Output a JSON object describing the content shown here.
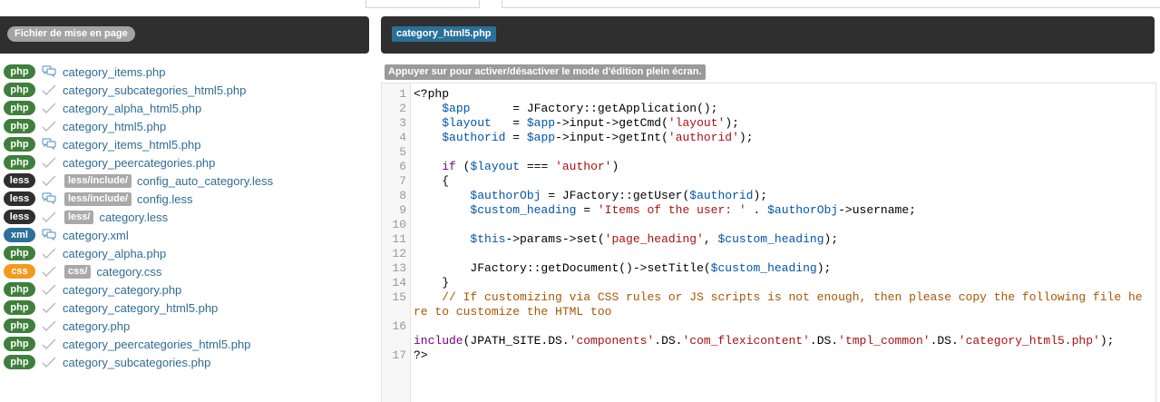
{
  "colors": {
    "php": "#3f7f3c",
    "less": "#2f2f2f",
    "xml": "#2a7099",
    "css": "#f39a1e",
    "link": "#2d6d96",
    "header_bg": "#2f2f2f"
  },
  "left_panel": {
    "header_label": "Fichier de mise en page",
    "files": [
      {
        "type": "php",
        "icon": "comment-icon",
        "folder": "",
        "name": "category_items.php"
      },
      {
        "type": "php",
        "icon": "check-icon",
        "folder": "",
        "name": "category_subcategories_html5.php"
      },
      {
        "type": "php",
        "icon": "check-icon",
        "folder": "",
        "name": "category_alpha_html5.php"
      },
      {
        "type": "php",
        "icon": "check-icon",
        "folder": "",
        "name": "category_html5.php"
      },
      {
        "type": "php",
        "icon": "comment-icon",
        "folder": "",
        "name": "category_items_html5.php"
      },
      {
        "type": "php",
        "icon": "check-icon",
        "folder": "",
        "name": "category_peercategories.php"
      },
      {
        "type": "less",
        "icon": "check-icon",
        "folder": "less/include/",
        "name": "config_auto_category.less"
      },
      {
        "type": "less",
        "icon": "comment-icon",
        "folder": "less/include/",
        "name": "config.less"
      },
      {
        "type": "less",
        "icon": "check-icon",
        "folder": "less/",
        "name": "category.less"
      },
      {
        "type": "xml",
        "icon": "comment-icon",
        "folder": "",
        "name": "category.xml"
      },
      {
        "type": "php",
        "icon": "check-icon",
        "folder": "",
        "name": "category_alpha.php"
      },
      {
        "type": "css",
        "icon": "check-icon",
        "folder": "css/",
        "name": "category.css"
      },
      {
        "type": "php",
        "icon": "check-icon",
        "folder": "",
        "name": "category_category.php"
      },
      {
        "type": "php",
        "icon": "check-icon",
        "folder": "",
        "name": "category_category_html5.php"
      },
      {
        "type": "php",
        "icon": "check-icon",
        "folder": "",
        "name": "category.php"
      },
      {
        "type": "php",
        "icon": "check-icon",
        "folder": "",
        "name": "category_peercategories_html5.php"
      },
      {
        "type": "php",
        "icon": "check-icon",
        "folder": "",
        "name": "category_subcategories.php"
      }
    ]
  },
  "right_panel": {
    "file_tag": "category_html5.php",
    "hint": "Appuyer sur pour activer/désactiver le mode d'édition plein écran.",
    "code_lines": [
      {
        "n": "1",
        "tokens": [
          [
            "t",
            "<?php"
          ]
        ]
      },
      {
        "n": "2",
        "tokens": [
          [
            "t",
            "    "
          ],
          [
            "v",
            "$app"
          ],
          [
            "t",
            "      = JFactory::getApplication();"
          ]
        ]
      },
      {
        "n": "3",
        "tokens": [
          [
            "t",
            "    "
          ],
          [
            "v",
            "$layout"
          ],
          [
            "t",
            "   = "
          ],
          [
            "v",
            "$app"
          ],
          [
            "t",
            "->input->getCmd("
          ],
          [
            "s",
            "'layout'"
          ],
          [
            "t",
            ");"
          ]
        ]
      },
      {
        "n": "4",
        "tokens": [
          [
            "t",
            "    "
          ],
          [
            "v",
            "$authorid"
          ],
          [
            "t",
            " = "
          ],
          [
            "v",
            "$app"
          ],
          [
            "t",
            "->input->getInt("
          ],
          [
            "s",
            "'authorid'"
          ],
          [
            "t",
            ");"
          ]
        ]
      },
      {
        "n": "5",
        "tokens": []
      },
      {
        "n": "6",
        "tokens": [
          [
            "t",
            "    "
          ],
          [
            "k",
            "if"
          ],
          [
            "t",
            " ("
          ],
          [
            "v",
            "$layout"
          ],
          [
            "t",
            " === "
          ],
          [
            "s",
            "'author'"
          ],
          [
            "t",
            ")"
          ]
        ]
      },
      {
        "n": "7",
        "tokens": [
          [
            "t",
            "    {"
          ]
        ]
      },
      {
        "n": "8",
        "tokens": [
          [
            "t",
            "        "
          ],
          [
            "v",
            "$authorObj"
          ],
          [
            "t",
            " = JFactory::getUser("
          ],
          [
            "v",
            "$authorid"
          ],
          [
            "t",
            ");"
          ]
        ]
      },
      {
        "n": "9",
        "tokens": [
          [
            "t",
            "        "
          ],
          [
            "v",
            "$custom_heading"
          ],
          [
            "t",
            " = "
          ],
          [
            "s",
            "'Items of the user: '"
          ],
          [
            "t",
            " . "
          ],
          [
            "v",
            "$authorObj"
          ],
          [
            "t",
            "->username;"
          ]
        ]
      },
      {
        "n": "10",
        "tokens": []
      },
      {
        "n": "11",
        "tokens": [
          [
            "t",
            "        "
          ],
          [
            "v",
            "$this"
          ],
          [
            "t",
            "->params->set("
          ],
          [
            "s",
            "'page_heading'"
          ],
          [
            "t",
            ", "
          ],
          [
            "v",
            "$custom_heading"
          ],
          [
            "t",
            ");"
          ]
        ]
      },
      {
        "n": "12",
        "tokens": []
      },
      {
        "n": "13",
        "tokens": [
          [
            "t",
            "        JFactory::getDocument()->setTitle("
          ],
          [
            "v",
            "$custom_heading"
          ],
          [
            "t",
            ");"
          ]
        ]
      },
      {
        "n": "14",
        "tokens": [
          [
            "t",
            "    }"
          ]
        ]
      },
      {
        "n": "15",
        "tokens": [
          [
            "t",
            "    "
          ],
          [
            "c",
            "// If customizing via CSS rules or JS scripts is not enough, then please copy the following file here to customize the HTML too"
          ]
        ]
      },
      {
        "n": "16",
        "tokens": [
          [
            "t",
            "\n"
          ],
          [
            "k",
            "include"
          ],
          [
            "t",
            "(JPATH_SITE.DS."
          ],
          [
            "s",
            "'components'"
          ],
          [
            "t",
            ".DS."
          ],
          [
            "s",
            "'com_flexicontent'"
          ],
          [
            "t",
            ".DS."
          ],
          [
            "s",
            "'tmpl_common'"
          ],
          [
            "t",
            ".DS."
          ],
          [
            "s",
            "'category_html5.php'"
          ],
          [
            "t",
            ");"
          ]
        ]
      },
      {
        "n": "17",
        "tokens": [
          [
            "t",
            "?>"
          ]
        ]
      }
    ]
  }
}
